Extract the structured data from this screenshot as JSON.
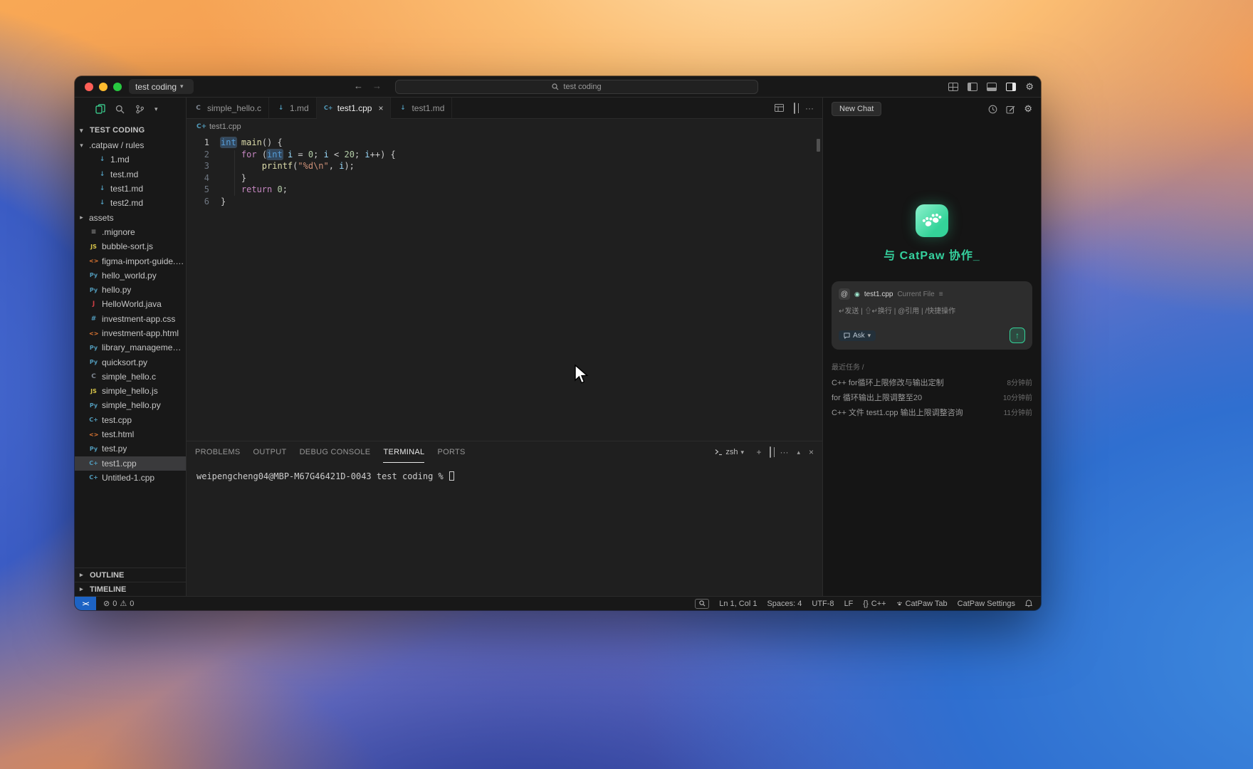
{
  "colors": {
    "accent": "#34d399",
    "remote_badge": "#1d63c4",
    "keyword": "#569cd6",
    "string": "#ce9178"
  },
  "window": {
    "titlebar": {
      "project": "test coding",
      "search_value": "test coding"
    },
    "explorer": {
      "title": "TEST CODING",
      "items": [
        {
          "label": ".catpaw / rules",
          "icon": null,
          "chev": "down",
          "indent": 1
        },
        {
          "label": "1.md",
          "icon": "md",
          "indent": 2
        },
        {
          "label": "test.md",
          "icon": "md",
          "indent": 2
        },
        {
          "label": "test1.md",
          "icon": "md",
          "indent": 2
        },
        {
          "label": "test2.md",
          "icon": "md",
          "indent": 2
        },
        {
          "label": "assets",
          "icon": null,
          "chev": "right",
          "indent": 1
        },
        {
          "label": ".mignore",
          "icon": "ignore",
          "indent": 1
        },
        {
          "label": "bubble-sort.js",
          "icon": "js",
          "indent": 1
        },
        {
          "label": "figma-import-guide.h...",
          "icon": "html",
          "indent": 1
        },
        {
          "label": "hello_world.py",
          "icon": "py",
          "indent": 1
        },
        {
          "label": "hello.py",
          "icon": "py",
          "indent": 1
        },
        {
          "label": "HelloWorld.java",
          "icon": "java",
          "indent": 1
        },
        {
          "label": "investment-app.css",
          "icon": "css",
          "indent": 1
        },
        {
          "label": "investment-app.html",
          "icon": "html",
          "indent": 1
        },
        {
          "label": "library_management...",
          "icon": "py",
          "indent": 1
        },
        {
          "label": "quicksort.py",
          "icon": "py",
          "indent": 1
        },
        {
          "label": "simple_hello.c",
          "icon": "c",
          "indent": 1
        },
        {
          "label": "simple_hello.js",
          "icon": "js",
          "indent": 1
        },
        {
          "label": "simple_hello.py",
          "icon": "py",
          "indent": 1
        },
        {
          "label": "test.cpp",
          "icon": "cpp",
          "indent": 1
        },
        {
          "label": "test.html",
          "icon": "html",
          "indent": 1
        },
        {
          "label": "test.py",
          "icon": "py",
          "indent": 1
        },
        {
          "label": "test1.cpp",
          "icon": "cpp",
          "indent": 1,
          "selected": true
        },
        {
          "label": "Untitled-1.cpp",
          "icon": "cpp",
          "indent": 1
        }
      ],
      "outline_label": "OUTLINE",
      "timeline_label": "TIMELINE"
    },
    "tabs": [
      {
        "label": "simple_hello.c",
        "icon": "c"
      },
      {
        "label": "1.md",
        "icon": "md"
      },
      {
        "label": "test1.cpp",
        "icon": "cpp",
        "active": true
      },
      {
        "label": "test1.md",
        "icon": "md"
      }
    ],
    "breadcrumb": "test1.cpp",
    "editor": {
      "lines": [
        {
          "num": "1",
          "tokens": [
            {
              "t": "int",
              "c": "kw",
              "h": true
            },
            {
              "t": " ",
              "c": "pln"
            },
            {
              "t": "main",
              "c": "fn"
            },
            {
              "t": "() {",
              "c": "pln"
            }
          ]
        },
        {
          "num": "2",
          "tokens": [
            {
              "t": "    ",
              "c": "pln"
            },
            {
              "t": "for",
              "c": "ctl"
            },
            {
              "t": " (",
              "c": "pln"
            },
            {
              "t": "int",
              "c": "kw",
              "h": true
            },
            {
              "t": " ",
              "c": "pln"
            },
            {
              "t": "i",
              "c": "var"
            },
            {
              "t": " = ",
              "c": "pln"
            },
            {
              "t": "0",
              "c": "num"
            },
            {
              "t": "; ",
              "c": "pln"
            },
            {
              "t": "i",
              "c": "var"
            },
            {
              "t": " < ",
              "c": "pln"
            },
            {
              "t": "20",
              "c": "num"
            },
            {
              "t": "; ",
              "c": "pln"
            },
            {
              "t": "i",
              "c": "var"
            },
            {
              "t": "++) {",
              "c": "pln"
            }
          ]
        },
        {
          "num": "3",
          "tokens": [
            {
              "t": "        ",
              "c": "pln"
            },
            {
              "t": "printf",
              "c": "fn"
            },
            {
              "t": "(",
              "c": "pln"
            },
            {
              "t": "\"%d\\n\"",
              "c": "str"
            },
            {
              "t": ", ",
              "c": "pln"
            },
            {
              "t": "i",
              "c": "var"
            },
            {
              "t": ");",
              "c": "pln"
            }
          ]
        },
        {
          "num": "4",
          "tokens": [
            {
              "t": "    }",
              "c": "pln"
            }
          ]
        },
        {
          "num": "5",
          "tokens": [
            {
              "t": "    ",
              "c": "pln"
            },
            {
              "t": "return",
              "c": "ctl"
            },
            {
              "t": " ",
              "c": "pln"
            },
            {
              "t": "0",
              "c": "num"
            },
            {
              "t": ";",
              "c": "pln"
            }
          ]
        },
        {
          "num": "6",
          "tokens": [
            {
              "t": "}",
              "c": "pln"
            }
          ]
        }
      ]
    },
    "panel": {
      "tabs": [
        "PROBLEMS",
        "OUTPUT",
        "DEBUG CONSOLE",
        "TERMINAL",
        "PORTS"
      ],
      "active": "TERMINAL",
      "shell": "zsh",
      "prompt": "weipengcheng04@MBP-M67G46421D-0043 test coding % "
    },
    "statusbar": {
      "errors": "0",
      "warnings": "0",
      "ln_col": "Ln 1, Col 1",
      "spaces": "Spaces: 4",
      "encoding": "UTF-8",
      "eol": "LF",
      "lang_icon": "{}",
      "lang": "C++",
      "catpaw_tab": "CatPaw Tab",
      "catpaw_settings": "CatPaw Settings"
    },
    "catpaw": {
      "new_chat": "New Chat",
      "headline": "与 CatPaw 协作_",
      "context_at": "@",
      "context_file": "test1.cpp",
      "context_label": "Current File",
      "hints": "↵发送 | ⇧↵换行 | @引用 | /快捷操作",
      "ask": "Ask",
      "recent_title": "最近任务 /",
      "recent": [
        {
          "title": "C++ for循环上限修改与输出定制",
          "time": "8分钟前"
        },
        {
          "title": "for 循环输出上限调整至20",
          "time": "10分钟前"
        },
        {
          "title": "C++ 文件 test1.cpp 输出上限调整咨询",
          "time": "11分钟前"
        }
      ]
    }
  }
}
